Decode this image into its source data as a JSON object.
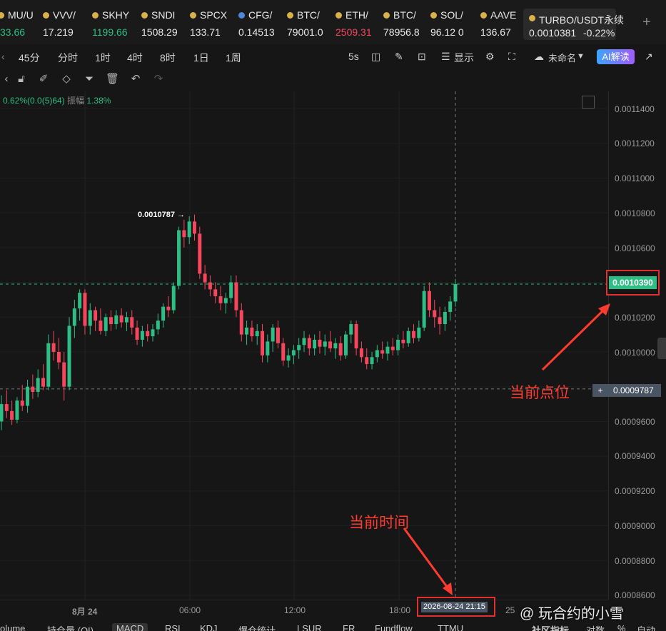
{
  "tickers": [
    {
      "symbol": "MU/U",
      "price": "33.66",
      "color": "green"
    },
    {
      "symbol": "VVV/",
      "price": "17.219",
      "color": "white"
    },
    {
      "symbol": "SKHY",
      "price": "1199.66",
      "color": "green"
    },
    {
      "symbol": "SNDI",
      "price": "1508.29",
      "color": "white"
    },
    {
      "symbol": "SPCX",
      "price": "133.71",
      "color": "white"
    },
    {
      "symbol": "CFG/",
      "price": "0.14513",
      "color": "white"
    },
    {
      "symbol": "BTC/",
      "price": "79001.0",
      "color": "white"
    },
    {
      "symbol": "ETH/",
      "price": "2509.31",
      "color": "red"
    },
    {
      "symbol": "BTC/",
      "price": "78956.8",
      "color": "white"
    },
    {
      "symbol": "SOL/",
      "price": "96.12 0",
      "color": "white"
    },
    {
      "symbol": "AAVE",
      "price": "136.67",
      "color": "white"
    }
  ],
  "active_ticker": {
    "symbol": "TURBO/USDT永续",
    "price": "0.0010381",
    "change": "-0.22%"
  },
  "add_tab": "+",
  "toolbar": {
    "intervals": [
      "45分",
      "分时",
      "1时",
      "4时",
      "8时",
      "1日",
      "1周"
    ],
    "refresh": "5s",
    "display": "显示",
    "layout_name": "未命名",
    "ai_label": "AI解读"
  },
  "info_line": {
    "change": "0.62%(0.0(5)64)",
    "amp_label": "振幅",
    "amp_value": "1.38%"
  },
  "max_label": "0.0010787 →",
  "current_price": "0.0010390",
  "crosshair_price": "0.0009787",
  "crosshair_plus": "+",
  "crosshair_time": "2026-08-24 21:15",
  "price_axis": [
    "0.0011400",
    "0.0011200",
    "0.0011000",
    "0.0010800",
    "0.0010600",
    "0.0010200",
    "0.0010000",
    "0.0009600",
    "0.0009400",
    "0.0009200",
    "0.0009000",
    "0.0008800",
    "0.0008600"
  ],
  "time_axis": [
    "8月 24",
    "06:00",
    "12:00",
    "18:00",
    "25"
  ],
  "bottom_tabs": [
    "olume",
    "持仓量 (OI)",
    "MACD",
    "RSI",
    "KDJ",
    "爆仓统计",
    "LSUR",
    "FR",
    "Fundflow",
    "TTMU",
    "社区指标",
    "对数",
    "%",
    "自动"
  ],
  "annotations": {
    "price": "当前点位",
    "time": "当前时间"
  },
  "watermark": "@ 玩合约的小雪",
  "colors": {
    "up": "#2ebd85",
    "down": "#f6465d",
    "annot": "#ff3b30",
    "bg": "#161616"
  },
  "chart_data": {
    "type": "candlestick",
    "y_range": [
      0.00086,
      0.00115
    ],
    "interval": "15m",
    "candles": [
      [
        0.00096,
        0.000975,
        0.000955,
        0.00097
      ],
      [
        0.00097,
        0.000978,
        0.000962,
        0.000966
      ],
      [
        0.000966,
        0.000972,
        0.000958,
        0.000961
      ],
      [
        0.000961,
        0.000974,
        0.000959,
        0.000972
      ],
      [
        0.000972,
        0.000981,
        0.000966,
        0.000969
      ],
      [
        0.000969,
        0.000984,
        0.000965,
        0.00098
      ],
      [
        0.00098,
        0.000987,
        0.000973,
        0.000977
      ],
      [
        0.000977,
        0.00099,
        0.000974,
        0.000985
      ],
      [
        0.000985,
        0.000993,
        0.000978,
        0.00098
      ],
      [
        0.00098,
        0.00101,
        0.000978,
        0.001005
      ],
      [
        0.001005,
        0.001012,
        0.000995,
        0.001
      ],
      [
        0.001,
        0.001008,
        0.00099,
        0.000994
      ],
      [
        0.000994,
        0.001,
        0.000972,
        0.00098
      ],
      [
        0.00098,
        0.00102,
        0.000978,
        0.001015
      ],
      [
        0.001015,
        0.00103,
        0.001008,
        0.001025
      ],
      [
        0.001025,
        0.001036,
        0.001018,
        0.001034
      ],
      [
        0.001034,
        0.001036,
        0.00101,
        0.001015
      ],
      [
        0.001015,
        0.001028,
        0.00101,
        0.001024
      ],
      [
        0.001024,
        0.001026,
        0.001012,
        0.001018
      ],
      [
        0.001018,
        0.001025,
        0.00101,
        0.001012
      ],
      [
        0.001012,
        0.001022,
        0.001009,
        0.00102
      ],
      [
        0.00102,
        0.001024,
        0.001012,
        0.001016
      ],
      [
        0.001016,
        0.001024,
        0.001013,
        0.001021
      ],
      [
        0.001021,
        0.001025,
        0.001014,
        0.001017
      ],
      [
        0.001017,
        0.001023,
        0.001012,
        0.00102
      ],
      [
        0.00102,
        0.001024,
        0.00101,
        0.001014
      ],
      [
        0.001014,
        0.001018,
        0.001004,
        0.001007
      ],
      [
        0.001007,
        0.001015,
        0.001003,
        0.001012
      ],
      [
        0.001012,
        0.001016,
        0.001006,
        0.001009
      ],
      [
        0.001009,
        0.001016,
        0.001006,
        0.001013
      ],
      [
        0.001013,
        0.001022,
        0.00101,
        0.001018
      ],
      [
        0.001018,
        0.001028,
        0.001014,
        0.001026
      ],
      [
        0.001026,
        0.001032,
        0.00102,
        0.001024
      ],
      [
        0.001024,
        0.00104,
        0.001022,
        0.001038
      ],
      [
        0.001038,
        0.001072,
        0.001036,
        0.00107
      ],
      [
        0.00107,
        0.001076,
        0.00106,
        0.001066
      ],
      [
        0.001066,
        0.001078,
        0.001062,
        0.001075
      ],
      [
        0.001075,
        0.001079,
        0.001064,
        0.001068
      ],
      [
        0.001068,
        0.001072,
        0.001042,
        0.001045
      ],
      [
        0.001045,
        0.00105,
        0.001036,
        0.00104
      ],
      [
        0.00104,
        0.001044,
        0.001032,
        0.001036
      ],
      [
        0.001036,
        0.00104,
        0.001028,
        0.001032
      ],
      [
        0.001032,
        0.001038,
        0.001024,
        0.001028
      ],
      [
        0.001028,
        0.001034,
        0.001022,
        0.001031
      ],
      [
        0.001031,
        0.001044,
        0.001028,
        0.00104
      ],
      [
        0.00104,
        0.001044,
        0.00102,
        0.001024
      ],
      [
        0.001024,
        0.001028,
        0.001006,
        0.00101
      ],
      [
        0.00101,
        0.001018,
        0.001004,
        0.001014
      ],
      [
        0.001014,
        0.001018,
        0.001006,
        0.001009
      ],
      [
        0.001009,
        0.001016,
        0.001004,
        0.001012
      ],
      [
        0.001012,
        0.001016,
        0.000994,
        0.000998
      ],
      [
        0.000998,
        0.00101,
        0.000994,
        0.001006
      ],
      [
        0.001006,
        0.001016,
        0.001,
        0.001014
      ],
      [
        0.001014,
        0.001018,
        0.001002,
        0.001005
      ],
      [
        0.001005,
        0.001008,
        0.000992,
        0.000995
      ],
      [
        0.000995,
        0.001002,
        0.000991,
        0.000998
      ],
      [
        0.000998,
        0.001004,
        0.000993,
        0.001001
      ],
      [
        0.001001,
        0.001008,
        0.000996,
        0.001004
      ],
      [
        0.001004,
        0.001012,
        0.001,
        0.001008
      ],
      [
        0.001008,
        0.00101,
        0.000998,
        0.001002
      ],
      [
        0.001002,
        0.00101,
        0.000998,
        0.001007
      ],
      [
        0.001007,
        0.001012,
        0.000999,
        0.001003
      ],
      [
        0.001003,
        0.00101,
        0.000998,
        0.001006
      ],
      [
        0.001006,
        0.001012,
        0.001,
        0.001002
      ],
      [
        0.001002,
        0.001008,
        0.000996,
        0.001005
      ],
      [
        0.001005,
        0.001009,
        0.000995,
        0.000998
      ],
      [
        0.000998,
        0.001012,
        0.000996,
        0.00101
      ],
      [
        0.00101,
        0.001018,
        0.001005,
        0.001016
      ],
      [
        0.001016,
        0.001018,
        0.000998,
        0.001002
      ],
      [
        0.001002,
        0.001006,
        0.000994,
        0.000997
      ],
      [
        0.000997,
        0.001002,
        0.00099,
        0.000993
      ],
      [
        0.000993,
        0.001,
        0.00099,
        0.000997
      ],
      [
        0.000997,
        0.001004,
        0.000994,
        0.001001
      ],
      [
        0.001001,
        0.001006,
        0.000996,
        0.000999
      ],
      [
        0.000999,
        0.001006,
        0.000995,
        0.001003
      ],
      [
        0.001003,
        0.001008,
        0.000998,
        0.001001
      ],
      [
        0.001001,
        0.00101,
        0.000998,
        0.001007
      ],
      [
        0.001007,
        0.001012,
        0.001002,
        0.001005
      ],
      [
        0.001005,
        0.001014,
        0.001003,
        0.001012
      ],
      [
        0.001012,
        0.001016,
        0.001005,
        0.001008
      ],
      [
        0.001008,
        0.001018,
        0.001006,
        0.001014
      ],
      [
        0.001014,
        0.001038,
        0.001012,
        0.001035
      ],
      [
        0.001035,
        0.00104,
        0.00102,
        0.001024
      ],
      [
        0.001024,
        0.00103,
        0.001014,
        0.00102
      ],
      [
        0.00102,
        0.001026,
        0.00101,
        0.001016
      ],
      [
        0.001016,
        0.001026,
        0.001012,
        0.001023
      ],
      [
        0.001023,
        0.001032,
        0.001018,
        0.001029
      ],
      [
        0.001029,
        0.001042,
        0.001026,
        0.001039
      ]
    ]
  }
}
